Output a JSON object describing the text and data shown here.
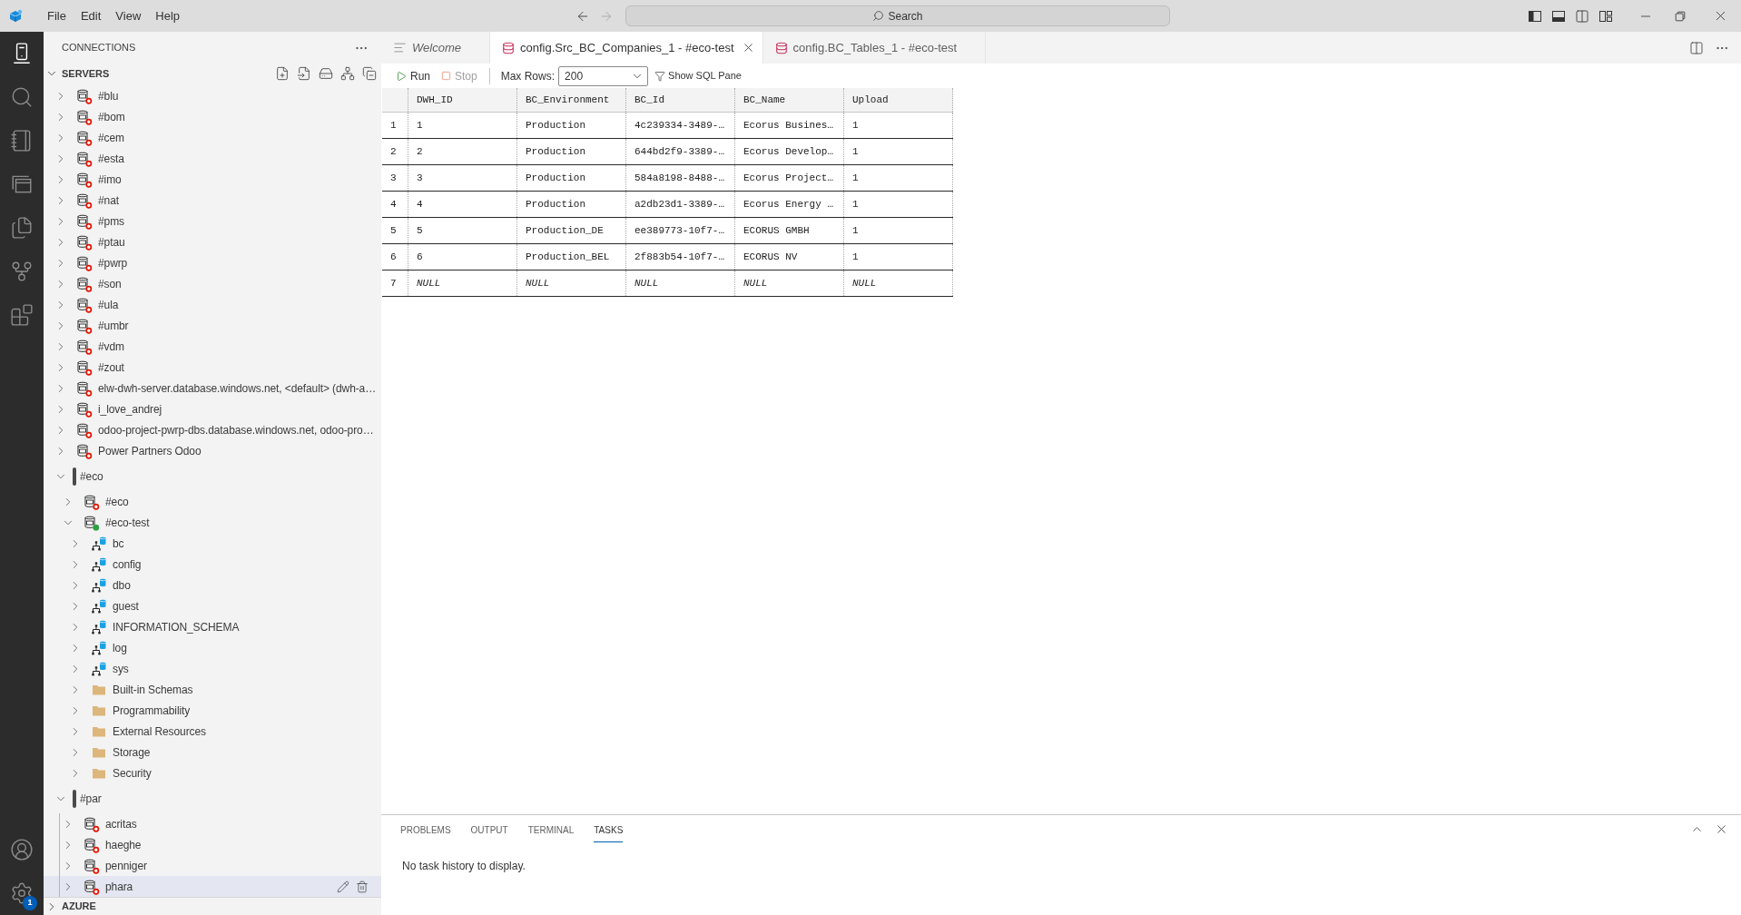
{
  "title_bar": {
    "menus": [
      "File",
      "Edit",
      "View",
      "Help"
    ],
    "navigation": [
      {
        "kind": "back",
        "disabled": false
      },
      {
        "kind": "forward",
        "disabled": true
      }
    ],
    "search": {
      "label": "Search"
    }
  },
  "activity_bar": {
    "top": [
      {
        "kind": "connections",
        "selected": true
      },
      {
        "kind": "search",
        "selected": false
      },
      {
        "kind": "notebooks",
        "selected": false
      },
      {
        "kind": "windows",
        "selected": false
      },
      {
        "kind": "explorer",
        "selected": false
      },
      {
        "kind": "source_control",
        "selected": false
      },
      {
        "kind": "extensions",
        "selected": false
      }
    ],
    "bottom": [
      {
        "kind": "accounts",
        "selected": false
      },
      {
        "kind": "settings",
        "selected": false,
        "badge": "1"
      }
    ]
  },
  "sidebar": {
    "title": "CONNECTIONS",
    "servers": {
      "label": "SERVERS",
      "expanded": true,
      "items": [
        {
          "kind": "server",
          "label": "#blu",
          "connected": false,
          "expanded": false,
          "selected": false
        },
        {
          "kind": "server",
          "label": "#bom",
          "connected": false,
          "expanded": false,
          "selected": false
        },
        {
          "kind": "server",
          "label": "#cem",
          "connected": false,
          "expanded": false,
          "selected": false
        },
        {
          "kind": "server",
          "label": "#esta",
          "connected": false,
          "expanded": false,
          "selected": false
        },
        {
          "kind": "server",
          "label": "#imo",
          "connected": false,
          "expanded": false,
          "selected": false
        },
        {
          "kind": "server",
          "label": "#nat",
          "connected": false,
          "expanded": false,
          "selected": false
        },
        {
          "kind": "server",
          "label": "#pms",
          "connected": false,
          "expanded": false,
          "selected": false
        },
        {
          "kind": "server",
          "label": "#ptau",
          "connected": false,
          "expanded": false,
          "selected": false
        },
        {
          "kind": "server",
          "label": "#pwrp",
          "connected": false,
          "expanded": false,
          "selected": false
        },
        {
          "kind": "server",
          "label": "#son",
          "connected": false,
          "expanded": false,
          "selected": false
        },
        {
          "kind": "server",
          "label": "#ula",
          "connected": false,
          "expanded": false,
          "selected": false
        },
        {
          "kind": "server",
          "label": "#umbr",
          "connected": false,
          "expanded": false,
          "selected": false
        },
        {
          "kind": "server",
          "label": "#vdm",
          "connected": false,
          "expanded": false,
          "selected": false
        },
        {
          "kind": "server",
          "label": "#zout",
          "connected": false,
          "expanded": false,
          "selected": false
        },
        {
          "kind": "server",
          "label": "elw-dwh-server.database.windows.net, <default> (dwh-a…",
          "connected": false,
          "expanded": false,
          "selected": false
        },
        {
          "kind": "server",
          "label": "i_love_andrej",
          "connected": false,
          "expanded": false,
          "selected": false
        },
        {
          "kind": "server",
          "label": "odoo-project-pwrp-dbs.database.windows.net, odoo-pro…",
          "connected": false,
          "expanded": false,
          "selected": false
        },
        {
          "kind": "server",
          "label": "Power Partners Odoo",
          "connected": false,
          "expanded": false,
          "selected": false
        },
        {
          "kind": "group",
          "label": "#eco",
          "expanded": true,
          "selected": false,
          "children": [
            {
              "kind": "server",
              "label": "#eco",
              "connected": false,
              "expanded": false,
              "selected": false
            },
            {
              "kind": "server",
              "label": "#eco-test",
              "connected": true,
              "expanded": true,
              "selected": false,
              "children": [
                {
                  "kind": "schema",
                  "label": "bc",
                  "expanded": false,
                  "selected": false
                },
                {
                  "kind": "schema",
                  "label": "config",
                  "expanded": false,
                  "selected": false
                },
                {
                  "kind": "schema",
                  "label": "dbo",
                  "expanded": false,
                  "selected": false
                },
                {
                  "kind": "schema",
                  "label": "guest",
                  "expanded": false,
                  "selected": false
                },
                {
                  "kind": "schema",
                  "label": "INFORMATION_SCHEMA",
                  "expanded": false,
                  "selected": false
                },
                {
                  "kind": "schema",
                  "label": "log",
                  "expanded": false,
                  "selected": false
                },
                {
                  "kind": "schema",
                  "label": "sys",
                  "expanded": false,
                  "selected": false
                },
                {
                  "kind": "folder",
                  "label": "Built-in Schemas",
                  "expanded": false,
                  "selected": false
                },
                {
                  "kind": "folder",
                  "label": "Programmability",
                  "expanded": false,
                  "selected": false
                },
                {
                  "kind": "folder",
                  "label": "External Resources",
                  "expanded": false,
                  "selected": false
                },
                {
                  "kind": "folder",
                  "label": "Storage",
                  "expanded": false,
                  "selected": false
                },
                {
                  "kind": "folder",
                  "label": "Security",
                  "expanded": false,
                  "selected": false
                }
              ]
            }
          ]
        },
        {
          "kind": "group",
          "label": "#par",
          "expanded": true,
          "selected": false,
          "children": [
            {
              "kind": "server",
              "label": "acritas",
              "connected": false,
              "expanded": false,
              "selected": false
            },
            {
              "kind": "server",
              "label": "haeghe",
              "connected": false,
              "expanded": false,
              "selected": false
            },
            {
              "kind": "server",
              "label": "penniger",
              "connected": false,
              "expanded": false,
              "selected": false
            },
            {
              "kind": "server",
              "label": "phara",
              "connected": false,
              "expanded": false,
              "selected": true
            }
          ]
        }
      ]
    },
    "azure": {
      "label": "AZURE",
      "expanded": false
    }
  },
  "editor": {
    "tabs": [
      {
        "kind": "welcome",
        "label": "Welcome",
        "selected": false
      },
      {
        "kind": "query",
        "label": "config.Src_BC_Companies_1 - #eco-test",
        "selected": true
      },
      {
        "kind": "query",
        "label": "config.BC_Tables_1 - #eco-test",
        "selected": false
      }
    ],
    "toolbar": {
      "run": {
        "label": "Run",
        "disabled": false
      },
      "stop": {
        "label": "Stop",
        "disabled": true
      },
      "max_rows": {
        "label": "Max Rows:",
        "value": "200"
      },
      "sql_pane": {
        "label": "Show SQL Pane"
      }
    },
    "results": {
      "columns": [
        "DWH_ID",
        "BC_Environment",
        "BC_Id",
        "BC_Name",
        "Upload"
      ],
      "rows": [
        {
          "number": "1",
          "null_row": false,
          "cells": [
            "1",
            "Production",
            "4c239334-3489-…",
            "Ecorus Busines…",
            "1"
          ]
        },
        {
          "number": "2",
          "null_row": false,
          "cells": [
            "2",
            "Production",
            "644bd2f9-3389-…",
            "Ecorus Develop…",
            "1"
          ]
        },
        {
          "number": "3",
          "null_row": false,
          "cells": [
            "3",
            "Production",
            "584a8198-8488-…",
            "Ecorus Project…",
            "1"
          ]
        },
        {
          "number": "4",
          "null_row": false,
          "cells": [
            "4",
            "Production",
            "a2db23d1-3389-…",
            "Ecorus Energy …",
            "1"
          ]
        },
        {
          "number": "5",
          "null_row": false,
          "cells": [
            "5",
            "Production_DE",
            "ee389773-10f7-…",
            "ECORUS GMBH",
            "1"
          ]
        },
        {
          "number": "6",
          "null_row": false,
          "cells": [
            "6",
            "Production_BEL",
            "2f883b54-10f7-…",
            "ECORUS NV",
            "1"
          ]
        },
        {
          "number": "7",
          "null_row": true,
          "cells": [
            "NULL",
            "NULL",
            "NULL",
            "NULL",
            "NULL"
          ]
        }
      ]
    }
  },
  "panel": {
    "tabs": [
      {
        "label": "PROBLEMS",
        "selected": false
      },
      {
        "label": "OUTPUT",
        "selected": false
      },
      {
        "label": "TERMINAL",
        "selected": false
      },
      {
        "label": "TASKS",
        "selected": true
      }
    ],
    "message": "No task history to display."
  }
}
